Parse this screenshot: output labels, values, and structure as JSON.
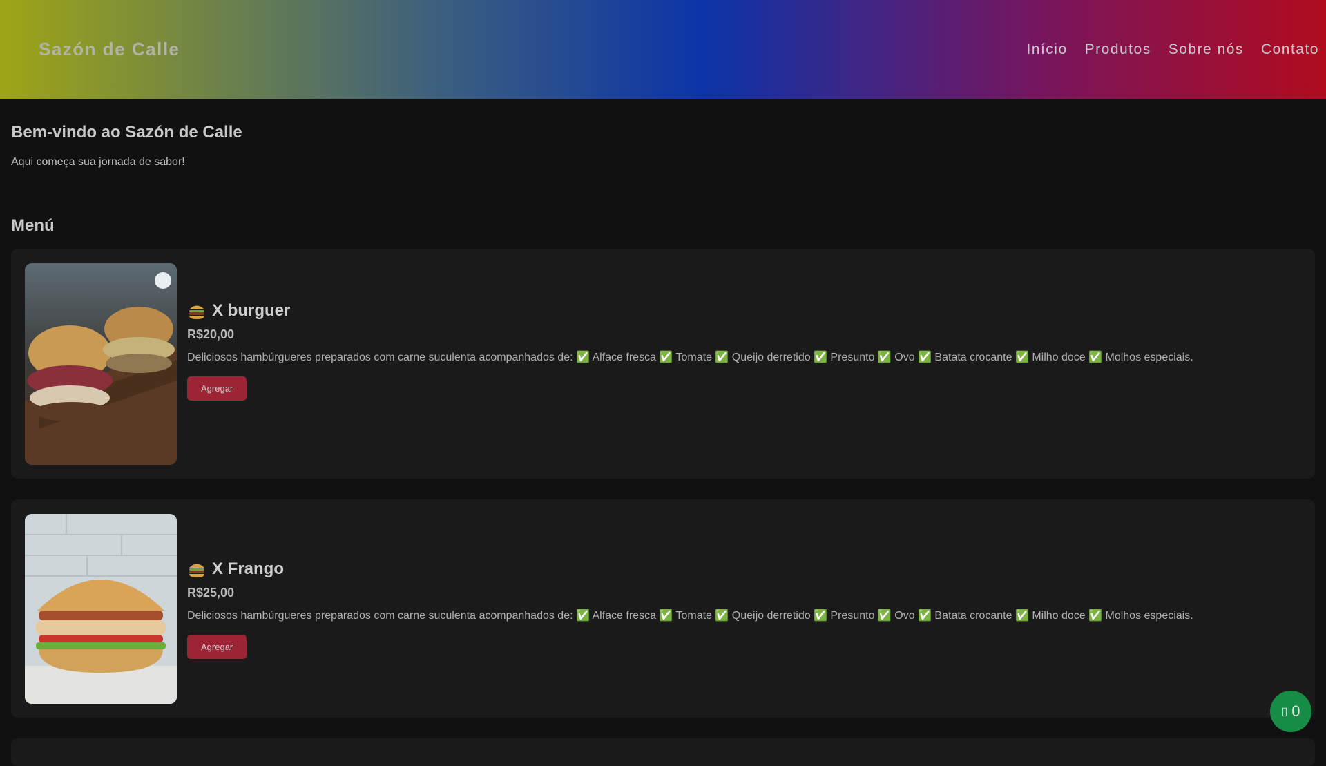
{
  "header": {
    "brand": "Sazón de Calle",
    "nav": [
      "Início",
      "Produtos",
      "Sobre nós",
      "Contato"
    ]
  },
  "welcome": {
    "title": "Bem-vindo ao Sazón de Calle",
    "subtitle": "Aqui começa sua jornada de sabor!"
  },
  "menu": {
    "title": "Menú",
    "items": [
      {
        "icon": "burger-icon",
        "name": "X burguer",
        "price": "R$20,00",
        "description": "Deliciosos hambúrgueres preparados com carne suculenta acompanhados de: ✅ Alface fresca ✅ Tomate ✅ Queijo derretido ✅ Presunto ✅ Ovo ✅ Batata crocante ✅ Milho doce ✅ Molhos especiais.",
        "button": "Agregar"
      },
      {
        "icon": "burger-icon",
        "name": "X Frango",
        "price": "R$25,00",
        "description": "Deliciosos hambúrgueres preparados com carne suculenta acompanhados de: ✅ Alface fresca ✅ Tomate ✅ Queijo derretido ✅ Presunto ✅ Ovo ✅ Batata crocante ✅ Milho doce ✅ Molhos especiais.",
        "button": "Agregar"
      }
    ]
  },
  "cart": {
    "icon": "cart-icon",
    "count": "0"
  },
  "colors": {
    "background": "#111111",
    "card": "#1a1a1a",
    "button": "#9c2434",
    "cart_fab": "#178c47"
  }
}
